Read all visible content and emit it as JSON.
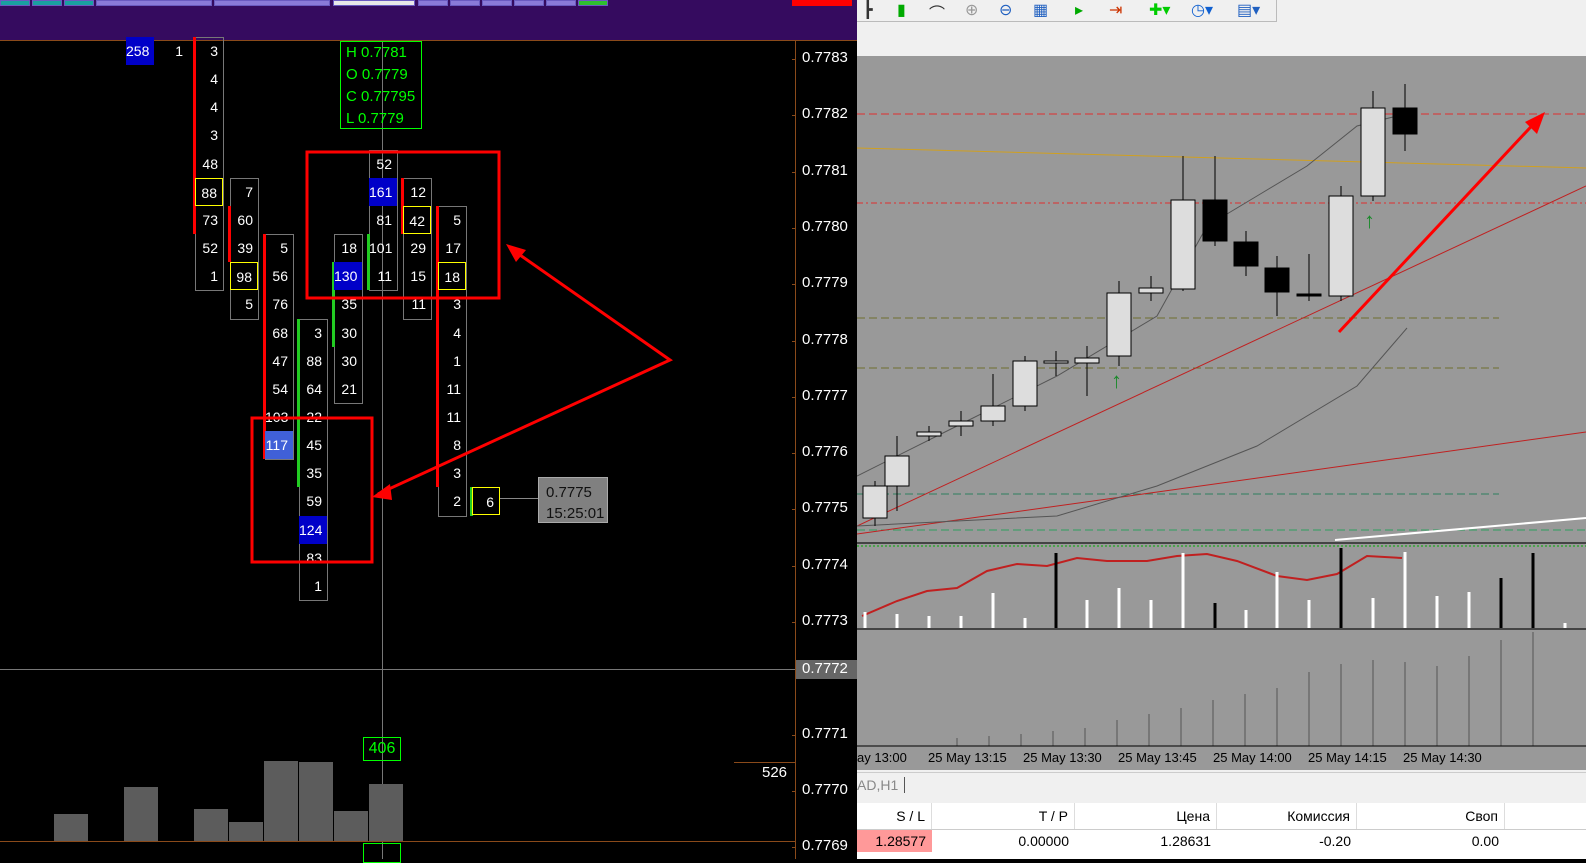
{
  "price_axis": [
    "0.7783",
    "0.7782",
    "0.7781",
    "0.7780",
    "0.7779",
    "0.7778",
    "0.7777",
    "0.7776",
    "0.7775",
    "0.7774",
    "0.7773",
    "0.7772",
    "0.7771",
    "0.7770",
    "0.7769"
  ],
  "current_price_label": "0.7772",
  "ohlc": {
    "h": "H 0.7781",
    "o": "O 0.7779",
    "c": "C 0.77795",
    "l": "L  0.7779"
  },
  "footprint": [
    {
      "col": -2,
      "start": 0,
      "cells": [
        {
          "v": "258",
          "s": "b"
        }
      ]
    },
    {
      "col": -1,
      "start": 0,
      "cells": [
        {
          "v": "1"
        }
      ]
    },
    {
      "col": 0,
      "start": 0,
      "bar": "red",
      "bar_rows": [
        0,
        6
      ],
      "cells": [
        {
          "v": "3"
        },
        {
          "v": "4"
        },
        {
          "v": "4"
        },
        {
          "v": "3"
        },
        {
          "v": "48"
        },
        {
          "v": "88",
          "s": "y"
        },
        {
          "v": "73"
        },
        {
          "v": "52"
        },
        {
          "v": "1"
        }
      ]
    },
    {
      "col": 1,
      "start": 5,
      "bar": "red",
      "bar_rows": [
        6,
        7
      ],
      "cells": [
        {
          "v": "7"
        },
        {
          "v": "60"
        },
        {
          "v": "39"
        },
        {
          "v": "98",
          "s": "y"
        },
        {
          "v": "5"
        }
      ]
    },
    {
      "col": 2,
      "start": 7,
      "bar": "red",
      "bar_rows": [
        7,
        14
      ],
      "cells": [
        {
          "v": "5"
        },
        {
          "v": "56"
        },
        {
          "v": "76"
        },
        {
          "v": "68"
        },
        {
          "v": "47"
        },
        {
          "v": "54"
        },
        {
          "v": "103"
        },
        {
          "v": "117",
          "s": "lb"
        }
      ]
    },
    {
      "col": 3,
      "start": 10,
      "bar": "green",
      "bar_rows": [
        10,
        15
      ],
      "cells": [
        {
          "v": "3"
        },
        {
          "v": "88"
        },
        {
          "v": "64"
        },
        {
          "v": "22"
        },
        {
          "v": "45"
        },
        {
          "v": "35"
        },
        {
          "v": "59"
        },
        {
          "v": "124",
          "s": "b"
        },
        {
          "v": "83"
        },
        {
          "v": "1"
        }
      ]
    },
    {
      "col": 4,
      "start": 7,
      "bar": "green",
      "bar_rows": [
        8,
        10
      ],
      "cells": [
        {
          "v": "18"
        },
        {
          "v": "130",
          "s": "b"
        },
        {
          "v": "35"
        },
        {
          "v": "30"
        },
        {
          "v": "30"
        },
        {
          "v": "21"
        }
      ]
    },
    {
      "col": 5,
      "start": 4,
      "bar": "green",
      "bar_rows": [
        7,
        8
      ],
      "cells": [
        {
          "v": "52"
        },
        {
          "v": "161",
          "s": "b"
        },
        {
          "v": "81"
        },
        {
          "v": "101"
        },
        {
          "v": "11"
        }
      ]
    },
    {
      "col": 6,
      "start": 5,
      "bar": "red",
      "bar_rows": [
        5,
        6
      ],
      "cells": [
        {
          "v": "12"
        },
        {
          "v": "42",
          "s": "y"
        },
        {
          "v": "29"
        },
        {
          "v": "15"
        },
        {
          "v": "11"
        }
      ]
    },
    {
      "col": 7,
      "start": 6,
      "bar": "red",
      "bar_rows": [
        6,
        15
      ],
      "cells": [
        {
          "v": "5"
        },
        {
          "v": "17"
        },
        {
          "v": "18",
          "s": "y"
        },
        {
          "v": "3"
        },
        {
          "v": "4"
        },
        {
          "v": "1"
        },
        {
          "v": "11"
        },
        {
          "v": "11"
        },
        {
          "v": "8"
        },
        {
          "v": "3"
        },
        {
          "v": "2"
        }
      ]
    },
    {
      "col": 8,
      "start": 16,
      "bar": "green",
      "bar_rows": [
        16,
        16
      ],
      "cells": [
        {
          "v": "6",
          "s": "y"
        }
      ]
    }
  ],
  "volume_bars": [
    27,
    0,
    54,
    0,
    32,
    19,
    80,
    79,
    30,
    57
  ],
  "volume_label": "406",
  "volume_side_label": "526",
  "tooltip": {
    "price": "0.7775",
    "time": "15:25:01"
  },
  "time_axis": [
    "ay 13:00",
    "25 May 13:15",
    "25 May 13:30",
    "25 May 13:45",
    "25 May 14:00",
    "25 May 14:15",
    "25 May 14:30"
  ],
  "chart_tab": "AD,H1",
  "table": {
    "headers": [
      "S / L",
      "T / P",
      "Цена",
      "Комиссия",
      "Своп"
    ],
    "row": [
      "1.28577",
      "0.00000",
      "1.28631",
      "-0.20",
      "0.00"
    ]
  }
}
